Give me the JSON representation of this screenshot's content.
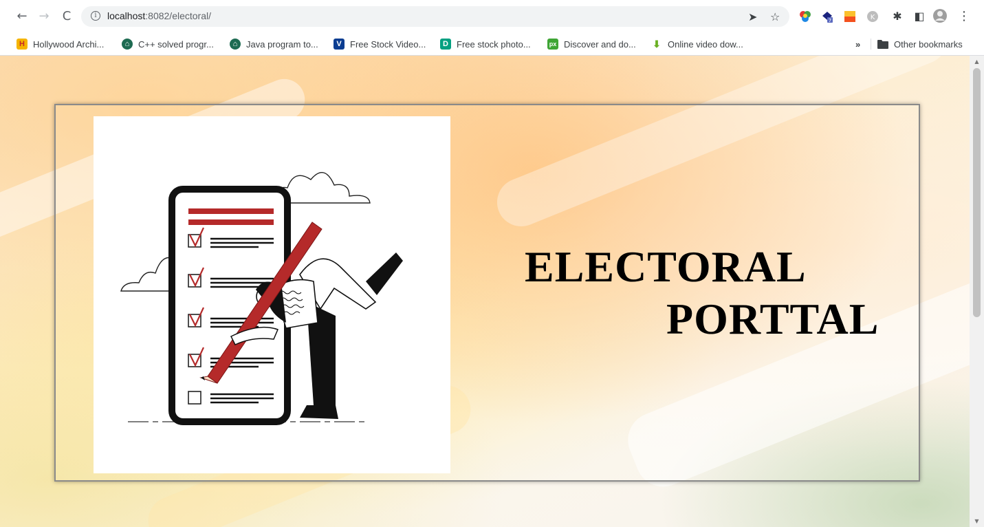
{
  "browser": {
    "url_host": "localhost",
    "url_rest": ":8082/electoral/",
    "bookmarks": [
      {
        "label": "Hollywood Archi...",
        "color": "#f5b400"
      },
      {
        "label": "C++ solved progr...",
        "color": "#1e6b52"
      },
      {
        "label": "Java program to...",
        "color": "#1e6b52"
      },
      {
        "label": "Free Stock Video...",
        "color": "#0b3d91"
      },
      {
        "label": "Free stock photo...",
        "color": "#05a081"
      },
      {
        "label": "Discover and do...",
        "color": "#3fa535"
      },
      {
        "label": "Online video dow...",
        "color": "#6ab023"
      }
    ],
    "bookmark_icons": [
      "H",
      "⌂",
      "⌂",
      "V",
      "D",
      "px",
      "⬇"
    ],
    "other_bookmarks": "Other bookmarks",
    "overflow": "»"
  },
  "page": {
    "title_line1": "ELECTORAL",
    "title_line2": "PORTTAL",
    "illustration": "voting-checklist-illustration",
    "accent_color": "#b52a2a"
  }
}
